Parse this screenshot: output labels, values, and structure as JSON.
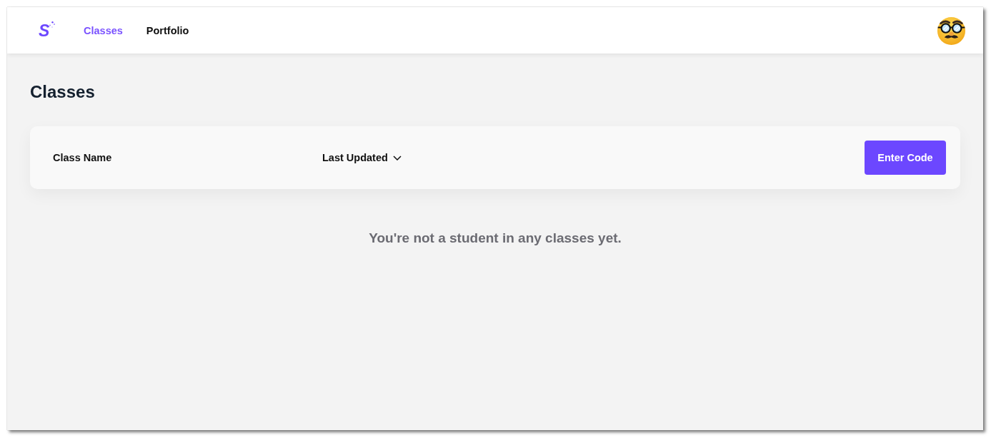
{
  "navbar": {
    "logo": {
      "letter": "S"
    },
    "links": [
      {
        "label": "Classes",
        "selected": true
      },
      {
        "label": "Portfolio",
        "selected": false
      }
    ]
  },
  "page": {
    "title": "Classes"
  },
  "table_header": {
    "columns": [
      {
        "label": "Class Name",
        "kind": "plain"
      },
      {
        "label": "Last Updated",
        "kind": "dropdown"
      }
    ],
    "button": "Enter Code"
  },
  "empty_message": "You're not a student in any classes yet."
}
